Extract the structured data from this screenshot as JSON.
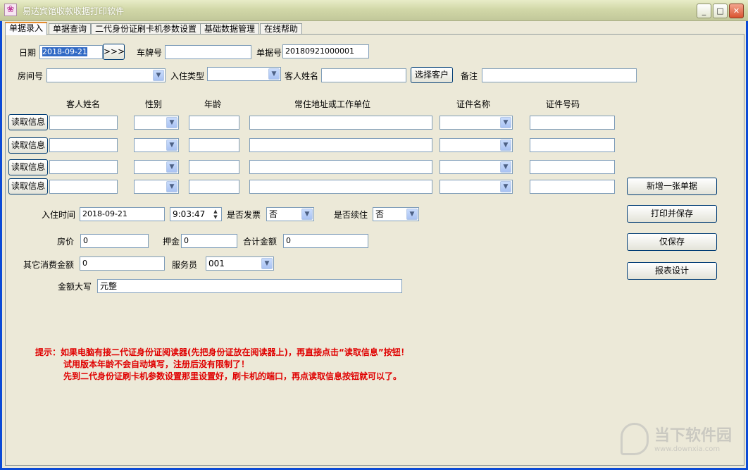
{
  "window": {
    "title": "易达宾馆收款收据打印软件",
    "app_icon": "flower-icon",
    "controls": {
      "minimize": "_",
      "maximize": "□",
      "close": "✕"
    }
  },
  "tabs": [
    {
      "label": "单据录入",
      "active": true
    },
    {
      "label": "单据查询"
    },
    {
      "label": "二代身份证刷卡机参数设置"
    },
    {
      "label": "基础数据管理"
    },
    {
      "label": "在线帮助"
    }
  ],
  "form": {
    "date_label": "日期",
    "date_value": "2018-09-21",
    "date_button": ">>>",
    "plate_label": "车牌号",
    "plate_value": "",
    "receipt_no_label": "单据号",
    "receipt_no_value": "20180921000001",
    "room_label": "房间号",
    "room_value": "",
    "checkin_type_label": "入住类型",
    "checkin_type_value": "",
    "guest_name_label": "客人姓名",
    "guest_name_value": "",
    "select_customer_button": "选择客户",
    "remark_label": "备注",
    "remark_value": ""
  },
  "guest_table": {
    "headers": [
      "客人姓名",
      "性别",
      "年龄",
      "常住地址或工作单位",
      "证件名称",
      "证件号码"
    ],
    "read_button": "读取信息",
    "rows": [
      {
        "name": "",
        "gender": "",
        "age": "",
        "address": "",
        "id_type": "",
        "id_no": ""
      },
      {
        "name": "",
        "gender": "",
        "age": "",
        "address": "",
        "id_type": "",
        "id_no": ""
      },
      {
        "name": "",
        "gender": "",
        "age": "",
        "address": "",
        "id_type": "",
        "id_no": ""
      },
      {
        "name": "",
        "gender": "",
        "age": "",
        "address": "",
        "id_type": "",
        "id_no": ""
      }
    ]
  },
  "checkin": {
    "time_label": "入住时间",
    "date_value": "2018-09-21",
    "time_value": "9:03:47",
    "invoice_label": "是否发票",
    "invoice_value": "否",
    "renew_label": "是否续住",
    "renew_value": "否"
  },
  "amounts": {
    "room_price_label": "房价",
    "room_price_value": "0",
    "deposit_label": "押金",
    "deposit_value": "0",
    "total_label": "合计金额",
    "total_value": "0",
    "other_label": "其它消费金额",
    "other_value": "0",
    "staff_label": "服务员",
    "staff_value": "001",
    "uppercase_label": "金额大写",
    "uppercase_value": "元整"
  },
  "actions": {
    "new_receipt": "新增一张单据",
    "print_save": "打印并保存",
    "save_only": "仅保存",
    "report_design": "报表设计"
  },
  "hints": {
    "line1": "提示：如果电脑有接二代证身份证阅读器(先把身份证放在阅读器上)，再直接点击“读取信息”按钮！",
    "line2": "试用版本年龄不会自动填写，注册后没有限制了！",
    "line3": "先到二代身份证刷卡机参数设置那里设置好，刷卡机的端口，再点读取信息按钮就可以了。"
  },
  "watermark": {
    "main": "当下软件园",
    "sub": "www.downxia.com"
  }
}
